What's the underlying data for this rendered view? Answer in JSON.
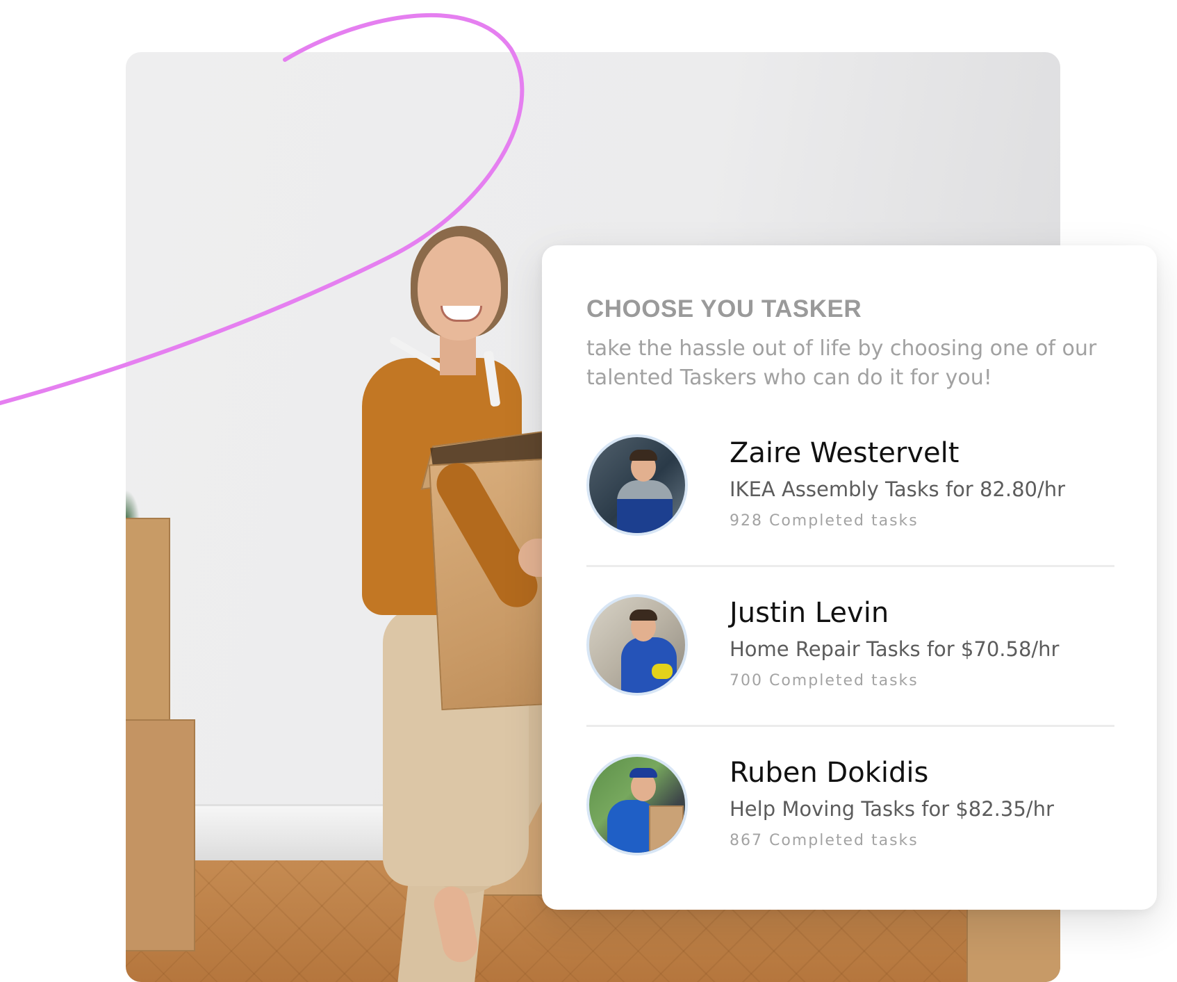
{
  "card": {
    "title": "CHOOSE YOU TASKER",
    "subtitle": "take the hassle out of life by choosing one of our talented Taskers who can do it for you!"
  },
  "taskers": [
    {
      "name": "Zaire Westervelt",
      "description": "IKEA Assembly Tasks for 82.80/hr",
      "completed": "928 Completed tasks"
    },
    {
      "name": "Justin Levin",
      "description": "Home Repair Tasks for $70.58/hr",
      "completed": "700 Completed tasks"
    },
    {
      "name": "Ruben Dokidis",
      "description": "Help Moving Tasks for $82.35/hr",
      "completed": "867 Completed tasks"
    }
  ],
  "colors": {
    "swoosh": "#e57ff0",
    "title": "#9a9a9a",
    "avatar_border": "#d8e6f5"
  }
}
